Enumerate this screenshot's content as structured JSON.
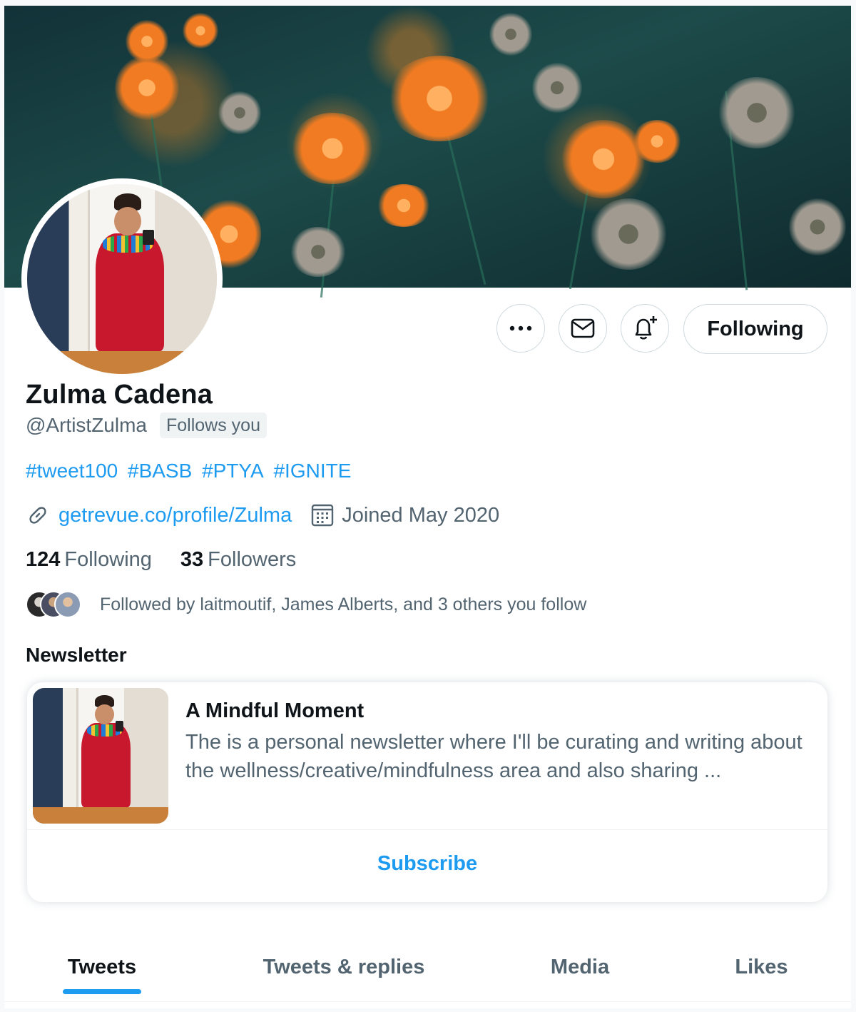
{
  "profile": {
    "name": "Zulma Cadena",
    "handle": "@ArtistZulma",
    "follows_you": "Follows you",
    "bio_tags": [
      "#tweet100",
      "#BASB",
      "#PTYA",
      "#IGNITE"
    ],
    "website": "getrevue.co/profile/Zulma",
    "joined": "Joined May 2020",
    "following_count": "124",
    "following_label": "Following",
    "followers_count": "33",
    "followers_label": "Followers",
    "followed_by": "Followed by laitmoutif, James Alberts, and 3 others you follow"
  },
  "actions": {
    "more_icon": "more-icon",
    "message_icon": "mail-icon",
    "notify_icon": "bell-plus-icon",
    "following_button": "Following"
  },
  "newsletter": {
    "section_title": "Newsletter",
    "title": "A Mindful Moment",
    "description": "The is a personal newsletter where I'll be curating and writing about the wellness/creative/mindfulness area and also sharing ...",
    "subscribe": "Subscribe"
  },
  "tabs": [
    {
      "label": "Tweets",
      "active": true
    },
    {
      "label": "Tweets & replies",
      "active": false
    },
    {
      "label": "Media",
      "active": false
    },
    {
      "label": "Likes",
      "active": false
    }
  ],
  "colors": {
    "accent": "#1d9bf0",
    "text": "#0f1419",
    "muted": "#536471",
    "border": "#cfd9de"
  }
}
